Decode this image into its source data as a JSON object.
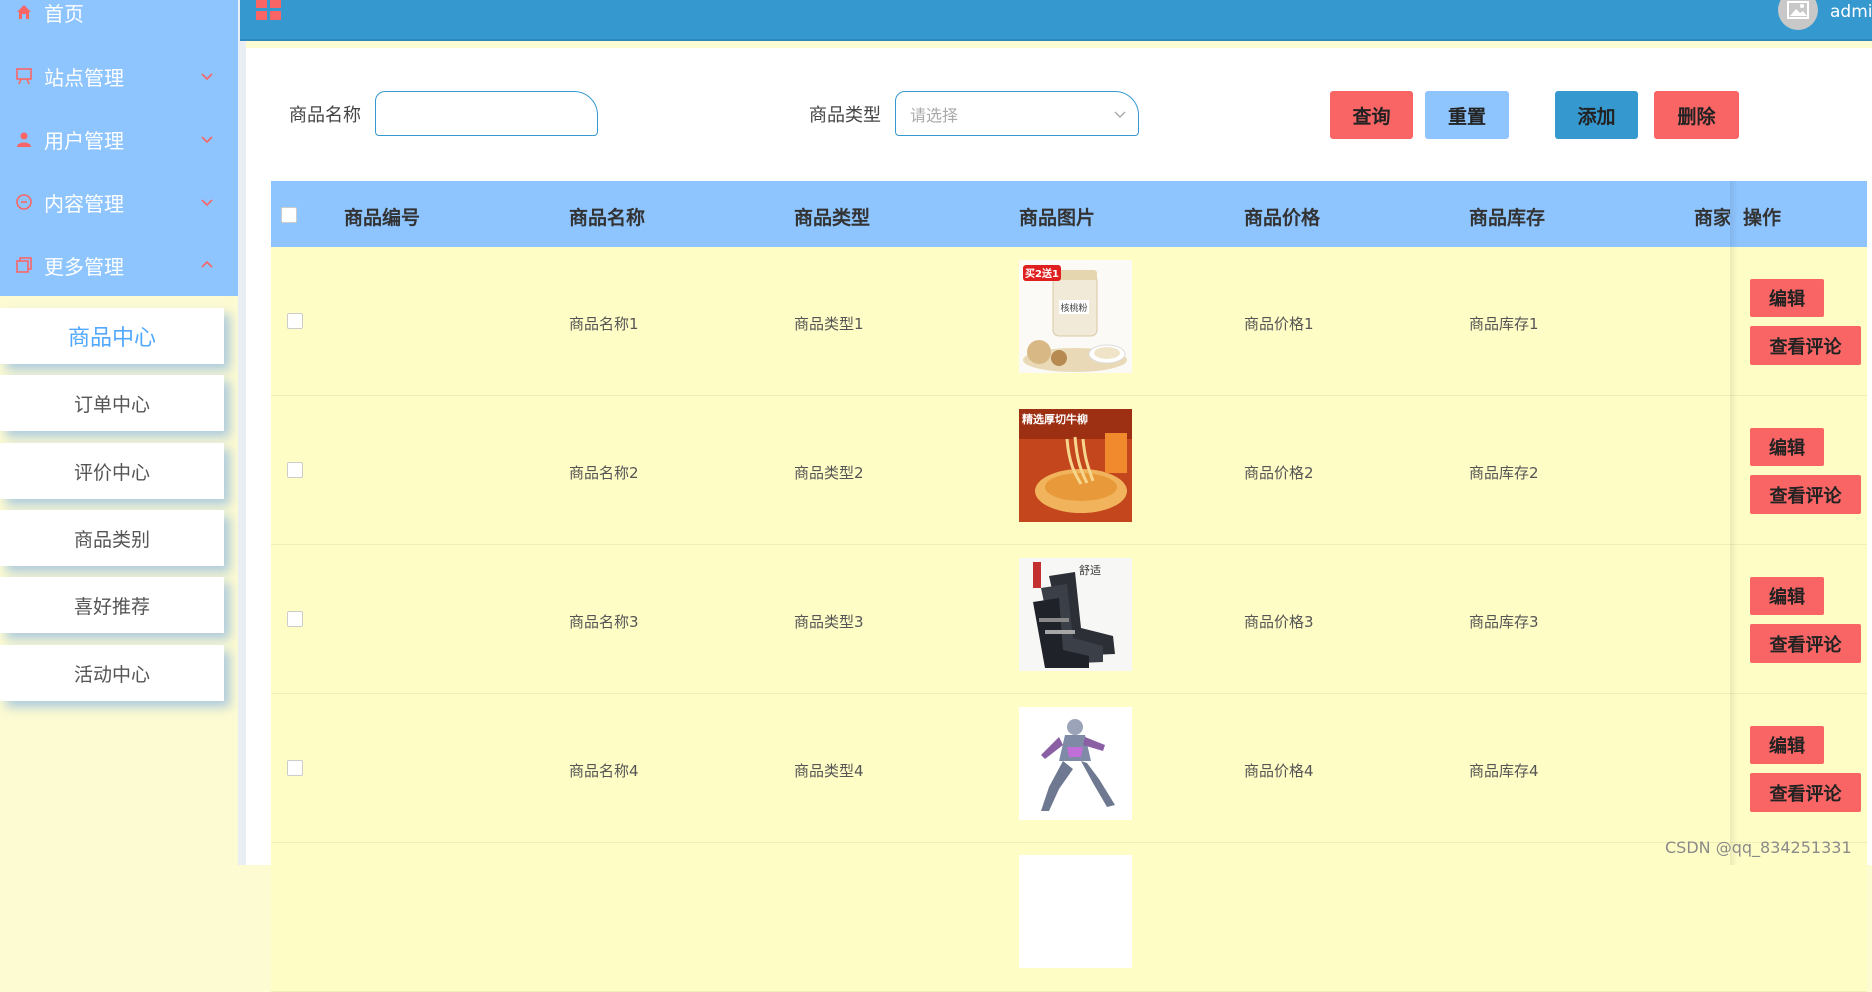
{
  "sidebar": {
    "nav": [
      {
        "label": "首页",
        "icon": "home-icon"
      },
      {
        "label": "站点管理",
        "icon": "easel-icon"
      },
      {
        "label": "用户管理",
        "icon": "user-icon"
      },
      {
        "label": "内容管理",
        "icon": "chat-icon"
      },
      {
        "label": "更多管理",
        "icon": "copy-icon"
      }
    ],
    "sub": [
      {
        "label": "商品中心",
        "active": true
      },
      {
        "label": "订单中心"
      },
      {
        "label": "评价中心"
      },
      {
        "label": "商品类别"
      },
      {
        "label": "喜好推荐"
      },
      {
        "label": "活动中心"
      }
    ]
  },
  "topbar": {
    "username": "admin"
  },
  "filters": {
    "name_label": "商品名称",
    "name_value": "",
    "type_label": "商品类型",
    "type_placeholder": "请选择"
  },
  "actions": {
    "query": "查询",
    "reset": "重置",
    "add": "添加",
    "delete": "删除"
  },
  "table": {
    "columns": [
      "商品编号",
      "商品名称",
      "商品类型",
      "商品图片",
      "商品价格",
      "商品库存",
      "商家",
      "操作"
    ],
    "rows": [
      {
        "id": "",
        "name": "商品名称1",
        "type": "商品类型1",
        "price": "商品价格1",
        "stock": "商品库存1",
        "image": "walnut-powder",
        "image_text": "买2送1"
      },
      {
        "id": "",
        "name": "商品名称2",
        "type": "商品类型2",
        "price": "商品价格2",
        "stock": "商品库存2",
        "image": "beef-noodles",
        "image_text": "精选厚切牛柳"
      },
      {
        "id": "",
        "name": "商品名称3",
        "type": "商品类型3",
        "price": "商品价格3",
        "stock": "商品库存3",
        "image": "socks",
        "image_text": "舒适"
      },
      {
        "id": "",
        "name": "商品名称4",
        "type": "商品类型4",
        "price": "商品价格4",
        "stock": "商品库存4",
        "image": "robot-figure",
        "image_text": ""
      }
    ],
    "row_actions": {
      "edit": "编辑",
      "comments": "查看评论"
    }
  },
  "watermark": "CSDN @qq_834251331",
  "colors": {
    "sidebar": "#8ec5ff",
    "topbar": "#3598cf",
    "row_bg": "#fffdc6",
    "danger": "#f96565",
    "accent": "#52a8ff"
  }
}
